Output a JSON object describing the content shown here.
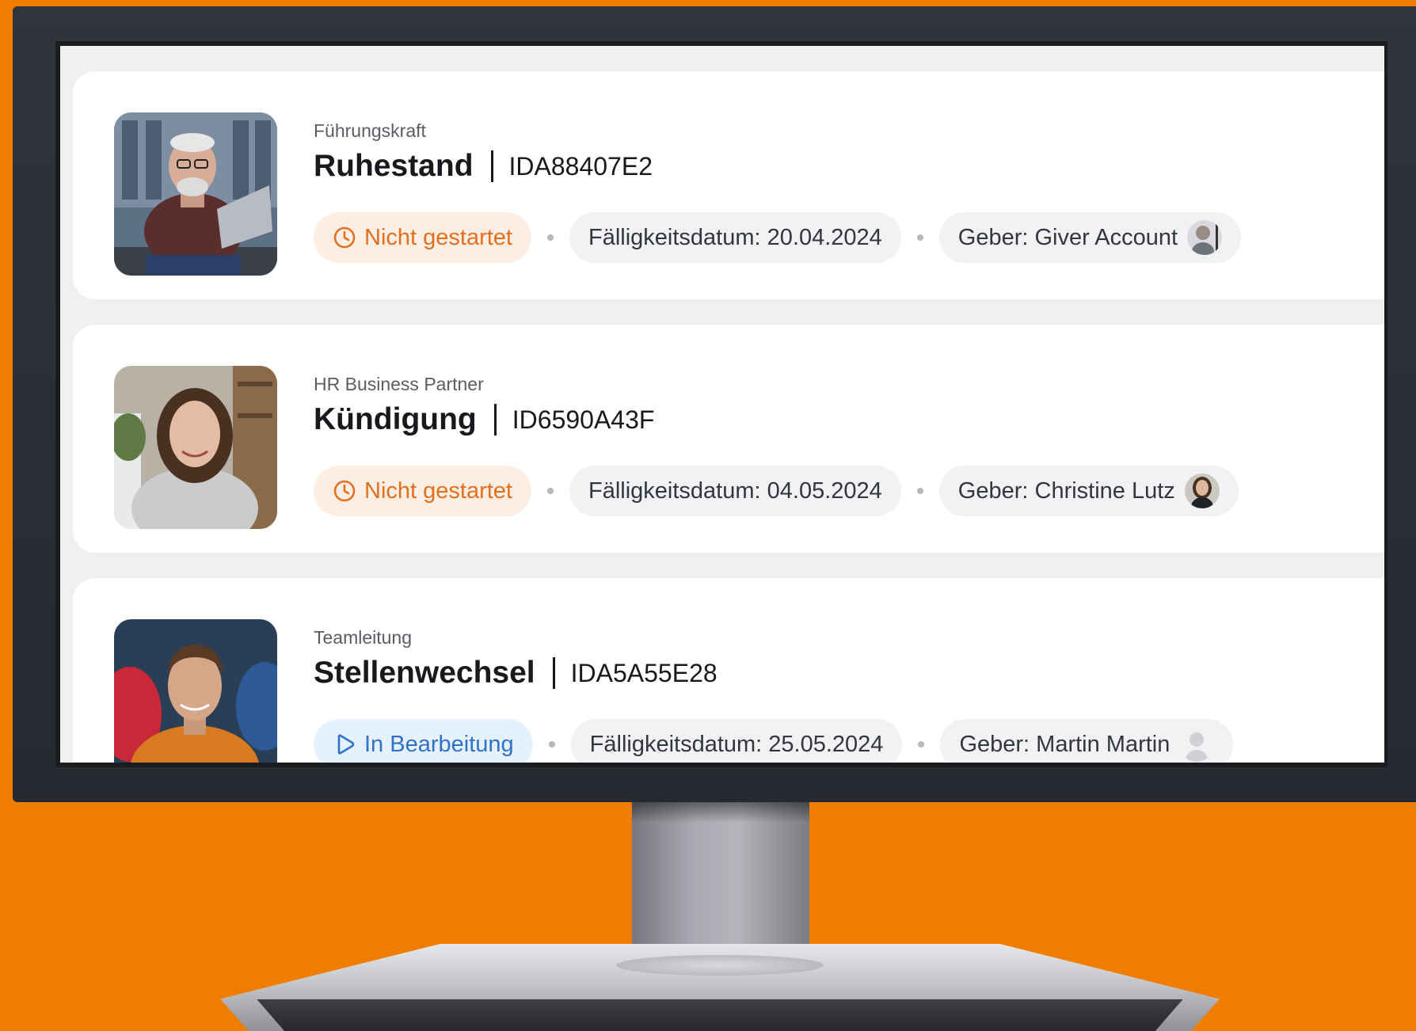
{
  "tasks": [
    {
      "role": "Führungskraft",
      "title": "Ruhestand",
      "id": "IDA88407E2",
      "status": "Nicht gestartet",
      "due": "Fälligkeitsdatum: 20.04.2024",
      "giver": "Geber: Giver Account"
    },
    {
      "role": "HR Business Partner",
      "title": "Kündigung",
      "id": "ID6590A43F",
      "status": "Nicht gestartet",
      "due": "Fälligkeitsdatum: 04.05.2024",
      "giver": "Geber: Christine Lutz"
    },
    {
      "role": "Teamleitung",
      "title": "Stellenwechsel",
      "id": "IDA5A55E28",
      "status": "In Bearbeitung",
      "due": "Fälligkeitsdatum: 25.05.2024",
      "giver": "Geber: Martin Martin"
    }
  ],
  "colors": {
    "background": "#ef7d00",
    "status_not_started": "#e2701f",
    "status_in_progress": "#2f73c8"
  },
  "icons": {
    "not_started": "clock-icon",
    "in_progress": "play-outline-icon"
  }
}
